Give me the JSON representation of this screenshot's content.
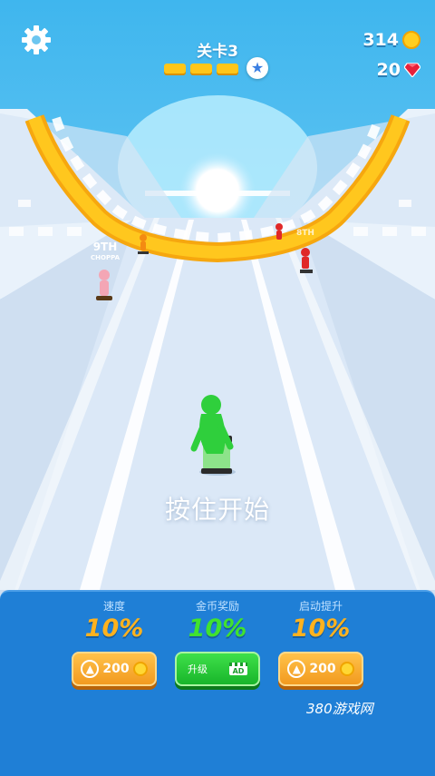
{
  "hud": {
    "level_label": "关卡3",
    "level_progress_segments": 3,
    "coins": "314",
    "gems": "20"
  },
  "track": {
    "runner_labels": [
      {
        "rank": "9TH",
        "name": "CHOPPA"
      },
      {
        "rank": "8TH",
        "name": ""
      }
    ]
  },
  "prompt": {
    "hold_to_start": "按住开始"
  },
  "upgrades": [
    {
      "title": "速度",
      "value": "10%",
      "button_price": "200"
    },
    {
      "title": "金币奖励",
      "value": "10%",
      "button_label": "升级",
      "ad_icon": "AD"
    },
    {
      "title": "启动提升",
      "value": "10%",
      "button_price": "200"
    }
  ],
  "watermark": "380游戏网",
  "colors": {
    "sky": "#5ec3ee",
    "track": "#dbe8f7",
    "rail": "#ffc61a",
    "player": "#2fcf3c",
    "panel": "#1f7fd6",
    "orange_button": "#f29a1f",
    "green_button": "#18b52a"
  }
}
